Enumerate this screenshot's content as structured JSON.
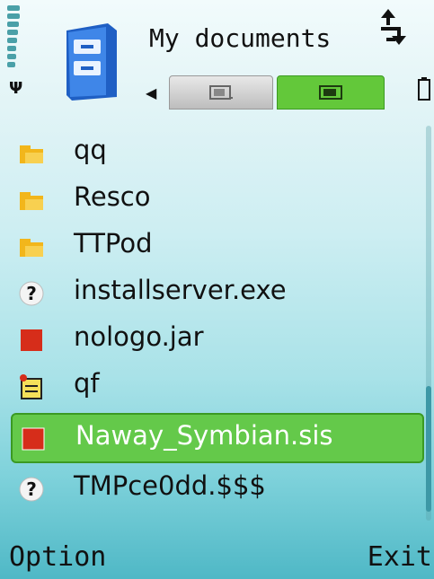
{
  "header": {
    "title": "My documents",
    "tabs": [
      {
        "name": "phone-memory",
        "active": false
      },
      {
        "name": "memory-card",
        "active": true
      }
    ]
  },
  "icons": {
    "signal": "signal-strength-icon",
    "antenna": "antenna-icon",
    "app": "file-manager-icon",
    "transfer": "data-transfer-icon",
    "battery": "battery-icon"
  },
  "files": [
    {
      "label": "qq",
      "icon": "folder-icon"
    },
    {
      "label": "Resco",
      "icon": "folder-icon"
    },
    {
      "label": "TTPod",
      "icon": "folder-icon"
    },
    {
      "label": "installserver.exe",
      "icon": "unknown-file-icon"
    },
    {
      "label": "nologo.jar",
      "icon": "application-file-icon"
    },
    {
      "label": "qf",
      "icon": "note-file-icon"
    },
    {
      "label": "Naway_Symbian.sis",
      "icon": "application-file-icon",
      "selected": true
    },
    {
      "label": "TMPce0dd.$$$",
      "icon": "unknown-file-icon"
    }
  ],
  "softkeys": {
    "left": "Option",
    "right": "Exit"
  },
  "colors": {
    "selection": "#64c94a",
    "accent": "#3d98a6",
    "app_icon": "#2a6fd6",
    "folder": "#f2b61b",
    "app_file": "#d62d1a"
  }
}
